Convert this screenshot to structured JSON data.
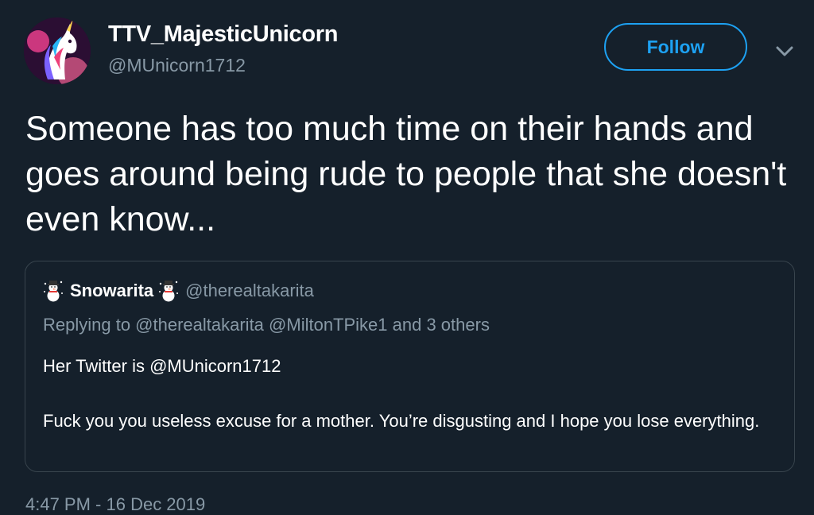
{
  "author": {
    "display_name": "TTV_MajesticUnicorn",
    "handle": "@MUnicorn1712",
    "avatar_icon": "unicorn-avatar"
  },
  "follow_button": {
    "label": "Follow",
    "color": "#1da1f2"
  },
  "menu": {
    "icon": "chevron-down-icon"
  },
  "tweet": {
    "text": "Someone has too much time on their hands and goes around being rude to people that she doesn't even know..."
  },
  "quoted_tweet": {
    "display_name": "Snowarita",
    "name_emoji": "snowman-icon",
    "handle": "@therealtakarita",
    "replying_to": "Replying to @therealtakarita @MiltonTPike1 and 3 others",
    "line1": "Her Twitter is @MUnicorn1712",
    "line2": "Fuck you you useless excuse for a mother. You’re disgusting and I hope you lose everything."
  },
  "timestamp": "4:47 PM - 16 Dec 2019",
  "colors": {
    "background": "#15202b",
    "secondary_text": "#8899a6",
    "border": "#38444d",
    "accent": "#1da1f2"
  }
}
